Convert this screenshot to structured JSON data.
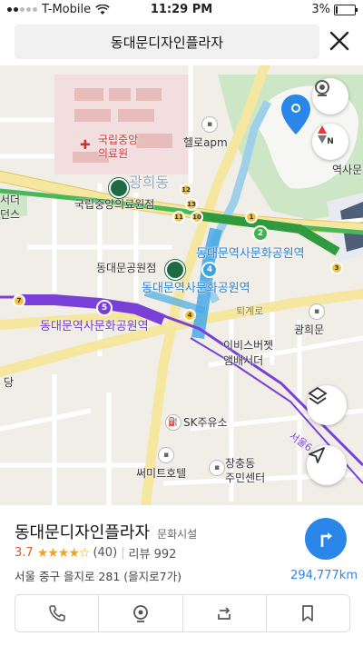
{
  "status_bar": {
    "carrier": "T-Mobile",
    "time": "11:29 PM",
    "battery": "3%"
  },
  "search": {
    "query": "동대문디자인플라자"
  },
  "map": {
    "labels": {
      "hospital": "국립중앙\n의료원",
      "hospital_station": "국립중앙의료원점",
      "helloapm": "헬로apm",
      "gwanghuidong": "광희동",
      "seodaemun": "서더\n던스",
      "park_store": "동대문공원점",
      "history_park_blue": "동대문역사문화공원역",
      "history_park_blue2": "동대문역사문화공원역",
      "history_park_purple": "동대문역사문화공원역",
      "toegyero": "퇴계로",
      "gwanghuimun": "광희문",
      "ebisu": "이비스버젯\n앰배서더",
      "sk": "SK주유소",
      "summit": "써미트호텔",
      "community": "장충동\n주민센터",
      "culture_park": "역사문화공",
      "dang": "당",
      "seoul_sign": "서울6"
    },
    "stations": {
      "s2": "2",
      "s4": "4",
      "s5": "5",
      "s1": "1",
      "s3": "3",
      "s7": "7",
      "s12": "12",
      "s13": "13",
      "s10": "10",
      "s11": "11",
      "s4b": "4"
    },
    "compass_label": "N"
  },
  "place": {
    "name": "동대문디자인플라자",
    "category": "문화시설",
    "rating": "3.7",
    "stars_value": 3.7,
    "review_count": "(40)",
    "review_label": "리뷰 992",
    "address": "서울 중구 을지로 281 (을지로7가)",
    "distance": "294,777km"
  },
  "colors": {
    "accent": "#2a86e8",
    "line2": "#3db54a",
    "line4": "#3aa3e0",
    "line5": "#7a3fd6"
  }
}
